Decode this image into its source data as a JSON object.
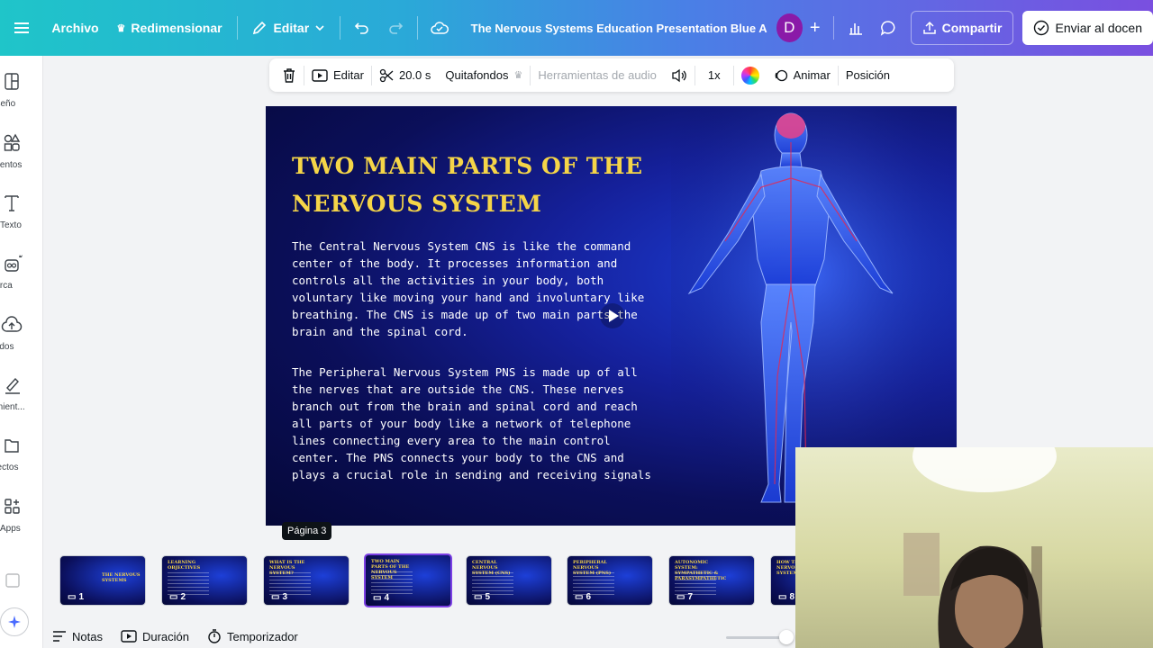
{
  "topbar": {
    "file": "Archivo",
    "resize": "Redimensionar",
    "edit": "Editar",
    "doc_title": "The Nervous Systems Education Presentation Blue Animat...",
    "avatar_initial": "D",
    "share": "Compartir",
    "send": "Enviar al docen"
  },
  "rail": {
    "items": [
      {
        "label": "Diseño",
        "icon": "layout-icon"
      },
      {
        "label": "ementos",
        "icon": "elements-icon"
      },
      {
        "label": "Texto",
        "icon": "text-icon"
      },
      {
        "label": "Marca",
        "icon": "brand-icon"
      },
      {
        "label": "ubidos",
        "icon": "upload-icon"
      },
      {
        "label": "ramient...",
        "icon": "tools-icon"
      },
      {
        "label": "oyectos",
        "icon": "folder-icon"
      },
      {
        "label": "Apps",
        "icon": "apps-icon"
      }
    ]
  },
  "toolbar": {
    "edit": "Editar",
    "duration": "20.0 s",
    "bg_remover": "Quitafondos",
    "audio_tools": "Herramientas de audio",
    "speed": "1x",
    "animate": "Animar",
    "position": "Posición"
  },
  "slide": {
    "title": "TWO MAIN PARTS OF THE NERVOUS SYSTEM",
    "paragraph1": "The Central Nervous System CNS is like the command center of the body. It processes information and controls all the activities in your body, both voluntary like moving your hand and involuntary like breathing. The CNS is made up of two main parts the brain and the spinal cord.",
    "paragraph2": "The Peripheral Nervous System PNS is made up of all the nerves that are outside the CNS. These nerves branch out from the brain and spinal cord and reach all parts of your body like a network of telephone lines connecting every area to the main control center. The PNS connects your body to the CNS and plays a crucial role in sending and receiving signals"
  },
  "pages": {
    "tooltip": "Página 3",
    "thumbs": [
      {
        "num": "1",
        "title": "THE NERVOUS SYSTEMS"
      },
      {
        "num": "2",
        "title": "LEARNING OBJECTIVES"
      },
      {
        "num": "3",
        "title": "WHAT IS THE NERVOUS SYSTEM?"
      },
      {
        "num": "4",
        "title": "TWO MAIN PARTS OF THE NERVOUS SYSTEM"
      },
      {
        "num": "5",
        "title": "CENTRAL NERVOUS SYSTEM (CNS)"
      },
      {
        "num": "6",
        "title": "PERIPHERAL NERVOUS SYSTEM (PNS)"
      },
      {
        "num": "7",
        "title": "AUTONOMIC SYSTEM: SYMPATHETIC & PARASYMPATHETIC"
      },
      {
        "num": "8",
        "title": "HOW THE NERVOUS SYSTEM WORKS"
      }
    ],
    "active_page": 4
  },
  "bottombar": {
    "notes": "Notas",
    "duration": "Duración",
    "timer": "Temporizador"
  },
  "colors": {
    "accent": "#7c3fe4",
    "slide_title": "#f5d548",
    "avatar": "#8a1aa8"
  }
}
